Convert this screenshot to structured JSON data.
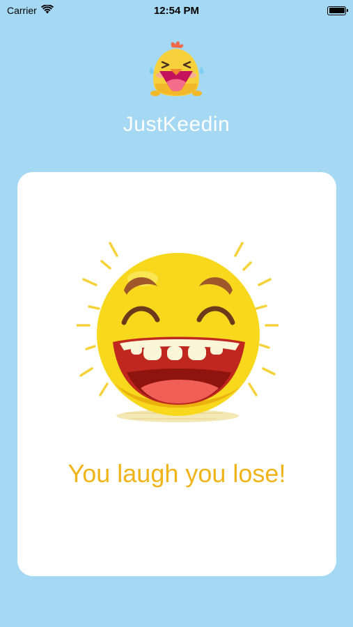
{
  "status_bar": {
    "carrier": "Carrier",
    "time": "12:54 PM",
    "wifi_icon": "wifi-icon",
    "battery_icon": "battery-icon"
  },
  "header": {
    "logo_icon": "laughing-chick-logo",
    "title": "JustKeedin"
  },
  "card": {
    "image_icon": "laughing-emoji",
    "tagline": "You laugh you lose!"
  },
  "colors": {
    "background": "#a5d8f3",
    "card": "#ffffff",
    "tagline": "#f0b318",
    "title": "#ffffff"
  }
}
